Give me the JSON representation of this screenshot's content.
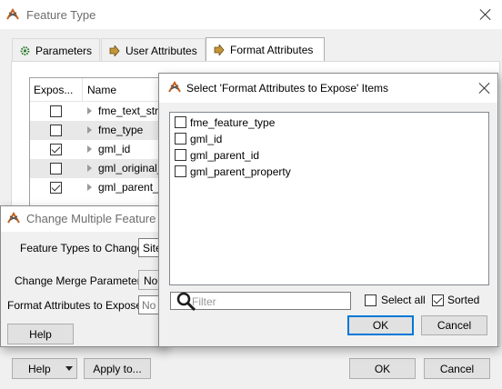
{
  "main_window": {
    "title": "Feature Type",
    "tabs": [
      {
        "label": "Parameters",
        "icon": "gear-icon"
      },
      {
        "label": "User Attributes",
        "icon": "arrow-right-icon"
      },
      {
        "label": "Format Attributes",
        "icon": "arrow-right-icon"
      }
    ],
    "active_tab": "Format Attributes",
    "grid": {
      "columns": [
        "Expos...",
        "Name"
      ],
      "rows": [
        {
          "expose": false,
          "name": "fme_text_stri"
        },
        {
          "expose": false,
          "name": "fme_type"
        },
        {
          "expose": true,
          "name": "gml_id"
        },
        {
          "expose": false,
          "name": "gml_original_"
        },
        {
          "expose": true,
          "name": "gml_parent_i"
        }
      ]
    },
    "buttons": {
      "help": "Help",
      "apply": "Apply to...",
      "ok": "OK",
      "cancel": "Cancel"
    }
  },
  "change_dialog": {
    "title": "Change Multiple Feature Ty",
    "fields": [
      {
        "label": "Feature Types to Change:",
        "value": "Site"
      },
      {
        "label": "Change Merge Parameters:",
        "value": "No"
      },
      {
        "label": "Format Attributes to Expose:",
        "value": "No i"
      }
    ],
    "help_label": "Help"
  },
  "select_dialog": {
    "title": "Select 'Format Attributes to Expose' Items",
    "items": [
      {
        "label": "fme_feature_type",
        "checked": false
      },
      {
        "label": "gml_id",
        "checked": false
      },
      {
        "label": "gml_parent_id",
        "checked": false
      },
      {
        "label": "gml_parent_property",
        "checked": false
      }
    ],
    "filter_placeholder": "Filter",
    "select_all_label": "Select all",
    "select_all_checked": false,
    "sorted_label": "Sorted",
    "sorted_checked": true,
    "ok_label": "OK",
    "cancel_label": "Cancel"
  },
  "colors": {
    "focus_blue": "#0078d7",
    "titlebar_text": "#6d6d6d"
  }
}
